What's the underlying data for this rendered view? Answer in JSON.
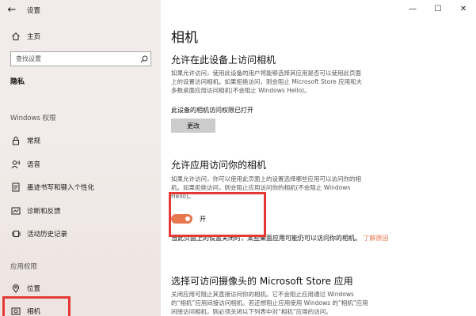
{
  "window": {
    "title": "设置",
    "back_glyph": "←",
    "minimize_glyph": "—",
    "maximize_glyph": "☐",
    "close_glyph": "✕"
  },
  "sidebar": {
    "home_label": "主页",
    "search": {
      "placeholder": "查找设置"
    },
    "section_title": "隐私",
    "windows_permissions_label": "Windows 权限",
    "windows_items": [
      {
        "label": "常规",
        "icon": "lock-icon"
      },
      {
        "label": "语音",
        "icon": "speech-icon"
      },
      {
        "label": "墨迹书写和键入个性化",
        "icon": "inking-icon"
      },
      {
        "label": "诊断和反馈",
        "icon": "diagnostics-icon"
      },
      {
        "label": "活动历史记录",
        "icon": "history-icon"
      }
    ],
    "app_permissions_label": "应用权限",
    "app_items": [
      {
        "label": "位置",
        "icon": "location-icon"
      },
      {
        "label": "相机",
        "icon": "camera-icon",
        "selected": true
      }
    ]
  },
  "main": {
    "page_title": "相机",
    "device_section": {
      "heading": "允许在此设备上访问相机",
      "lines": [
        "如果允许访问，使用此设备的用户将能够选择其应用是否可以使用此页面",
        "上的设置访问相机。如果拒绝访问，则会阻止 Microsoft Store 应用和大",
        "多数桌面应用访问相机(不会阻止 Windows Hello)。"
      ],
      "status": "此设备的相机访问权限已打开",
      "change_button": "更改"
    },
    "apps_section": {
      "heading": "允许应用访问你的相机",
      "lines": [
        "如果允许访问，你可以使用此页面上的设置选择哪些应用可以访问你的相",
        "机。如果拒绝访问，则会阻止应用访问你的相机(不会阻止 Windows",
        "Hello)。"
      ],
      "toggle_state": "开",
      "toggle_on": true,
      "note_text": "当此页面上的设置关闭时，某些桌面应用可能仍可以访问你的相机。",
      "note_link": "了解原因"
    },
    "store_section": {
      "heading": "选择可访问摄像头的 Microsoft Store 应用",
      "lines": [
        "关闭应用可阻止其直接访问你的相机。它不会阻止应用通过 Windows",
        "的“相机”应用间接访问相机。若还想阻止应用使用 Windows 的“相机”应用",
        "间接访问相机，则必须关闭以下列表中对“相机”应用的访问。"
      ]
    }
  },
  "colors": {
    "accent": "#e8764f",
    "highlight_border": "#e53935",
    "sidebar_bg": "#f1ebe9"
  }
}
